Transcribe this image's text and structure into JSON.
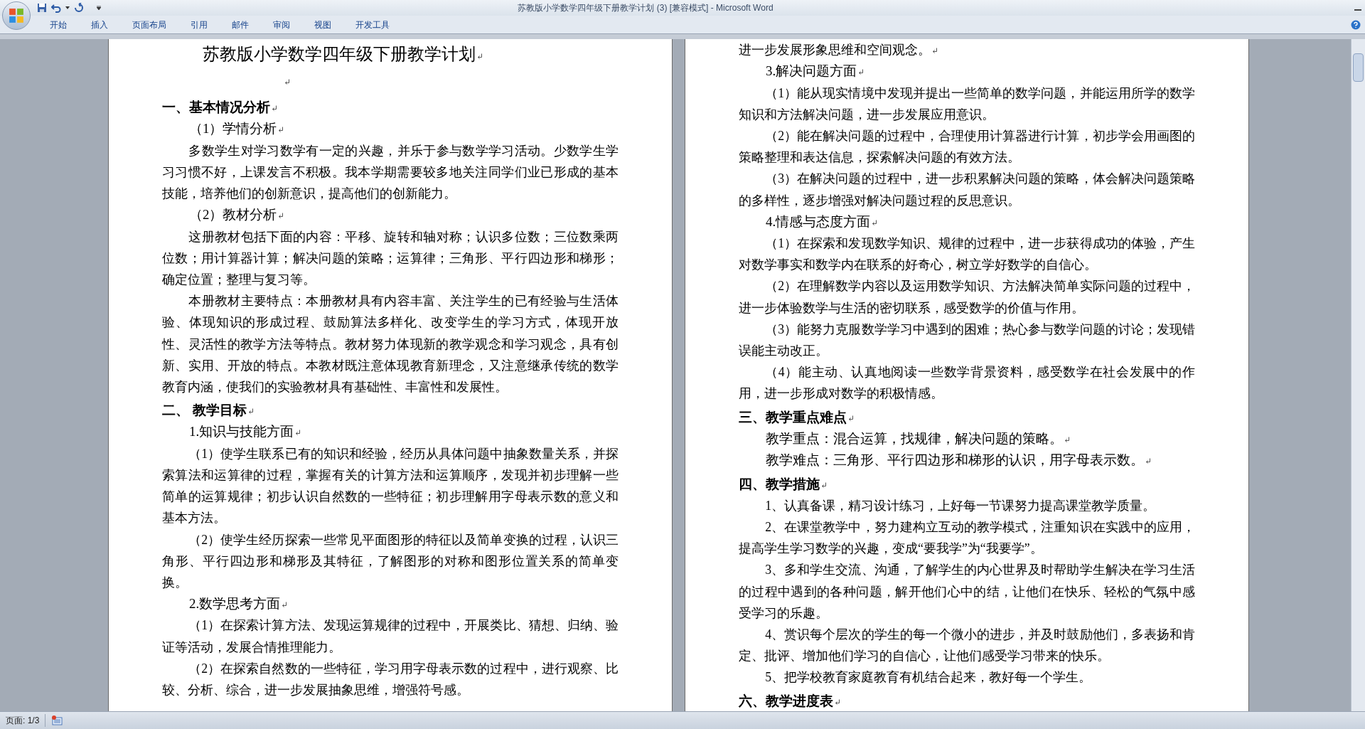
{
  "window": {
    "title": "苏教版小学数学四年级下册教学计划 (3) [兼容模式] - Microsoft Word"
  },
  "ribbon_tabs": [
    {
      "label": "开始",
      "selected": false
    },
    {
      "label": "插入",
      "selected": false
    },
    {
      "label": "页面布局",
      "selected": false
    },
    {
      "label": "引用",
      "selected": false
    },
    {
      "label": "邮件",
      "selected": false
    },
    {
      "label": "审阅",
      "selected": false
    },
    {
      "label": "视图",
      "selected": false
    },
    {
      "label": "开发工具",
      "selected": false
    }
  ],
  "pages": [
    {
      "blocks": [
        {
          "kind": "title",
          "text": "苏教版小学数学四年级下册教学计划"
        },
        {
          "kind": "blank"
        },
        {
          "kind": "heading",
          "text": "一、基本情况分析"
        },
        {
          "kind": "sub",
          "text": "（1）学情分析"
        },
        {
          "kind": "para",
          "text": "多数学生对学习数学有一定的兴趣，并乐于参与数学学习活动。少数学生学习习惯不好，上课发言不积极。我本学期需要较多地关注同学们业已形成的基本技能，培养他们的创新意识，提高他们的创新能力。"
        },
        {
          "kind": "sub",
          "text": "（2）教材分析"
        },
        {
          "kind": "para",
          "text": "这册教材包括下面的内容：平移、旋转和轴对称；认识多位数；三位数乘两位数；用计算器计算；解决问题的策略；运算律；三角形、平行四边形和梯形；确定位置；整理与复习等。"
        },
        {
          "kind": "para",
          "text": "本册教材主要特点：本册教材具有内容丰富、关注学生的已有经验与生活体验、体现知识的形成过程、鼓励算法多样化、改变学生的学习方式，体现开放性、灵活性的教学方法等特点。教材努力体现新的教学观念和学习观念，具有创新、实用、开放的特点。本教材既注意体现教育新理念，又注意继承传统的数学教育内涵，使我们的实验教材具有基础性、丰富性和发展性。"
        },
        {
          "kind": "heading",
          "text": "二、 教学目标"
        },
        {
          "kind": "sub",
          "text": "1.知识与技能方面"
        },
        {
          "kind": "para",
          "text": "（1）使学生联系已有的知识和经验，经历从具体问题中抽象数量关系，并探索算法和运算律的过程，掌握有关的计算方法和运算顺序，发现并初步理解一些简单的运算规律；初步认识自然数的一些特征；初步理解用字母表示数的意义和基本方法。"
        },
        {
          "kind": "para",
          "text": "（2）使学生经历探索一些常见平面图形的特征以及简单变换的过程，认识三角形、平行四边形和梯形及其特征，了解图形的对称和图形位置关系的简单变换。"
        },
        {
          "kind": "sub",
          "text": "2.数学思考方面"
        },
        {
          "kind": "para",
          "text": "（1）在探索计算方法、发现运算规律的过程中，开展类比、猜想、归纳、验证等活动，发展合情推理能力。"
        },
        {
          "kind": "para",
          "text": "（2）在探索自然数的一些特征，学习用字母表示数的过程中，进行观察、比较、分析、综合，进一步发展抽象思维，增强符号感。"
        }
      ]
    },
    {
      "blocks": [
        {
          "kind": "cont",
          "text": "进一步发展形象思维和空间观念。"
        },
        {
          "kind": "sub",
          "text": "3.解决问题方面"
        },
        {
          "kind": "para",
          "text": "（1）能从现实情境中发现并提出一些简单的数学问题，并能运用所学的数学知识和方法解决问题，进一步发展应用意识。"
        },
        {
          "kind": "para",
          "text": "（2）能在解决问题的过程中，合理使用计算器进行计算，初步学会用画图的策略整理和表达信息，探索解决问题的有效方法。"
        },
        {
          "kind": "para",
          "text": "（3）在解决问题的过程中，进一步积累解决问题的策略，体会解决问题策略的多样性，逐步增强对解决问题过程的反思意识。"
        },
        {
          "kind": "sub",
          "text": "4.情感与态度方面"
        },
        {
          "kind": "para",
          "text": "（1）在探索和发现数学知识、规律的过程中，进一步获得成功的体验，产生对数学事实和数学内在联系的好奇心，树立学好数学的自信心。"
        },
        {
          "kind": "para",
          "text": "（2）在理解数学内容以及运用数学知识、方法解决简单实际问题的过程中，进一步体验数学与生活的密切联系，感受数学的价值与作用。"
        },
        {
          "kind": "para",
          "text": "（3）能努力克服数学学习中遇到的困难；热心参与数学问题的讨论；发现错误能主动改正。"
        },
        {
          "kind": "para",
          "text": "（4）能主动、认真地阅读一些数学背景资料，感受数学在社会发展中的作用，进一步形成对数学的积极情感。"
        },
        {
          "kind": "heading",
          "text": "三、教学重点难点"
        },
        {
          "kind": "sub",
          "text": "教学重点：混合运算，找规律，解决问题的策略。"
        },
        {
          "kind": "sub",
          "text": "教学难点：三角形、平行四边形和梯形的认识，用字母表示数。"
        },
        {
          "kind": "heading",
          "text": "四、教学措施"
        },
        {
          "kind": "para",
          "text": "1、认真备课，精习设计练习，上好每一节课努力提高课堂教学质量。"
        },
        {
          "kind": "para",
          "text": "2、在课堂教学中，努力建构立互动的教学模式，注重知识在实践中的应用，提高学生学习数学的兴趣，变成“要我学”为“我要学”。"
        },
        {
          "kind": "para",
          "text": "3、多和学生交流、沟通，了解学生的内心世界及时帮助学生解决在学习生活的过程中遇到的各种问题，解开他们心中的结，让他们在快乐、轻松的气氛中感受学习的乐趣。"
        },
        {
          "kind": "para",
          "text": "4、赏识每个层次的学生的每一个微小的进步，并及时鼓励他们，多表扬和肯定、批评、增加他们学习的自信心，让他们感受学习带来的快乐。"
        },
        {
          "kind": "para",
          "text": "5、把学校教育家庭教育有机结合起来，教好每一个学生。"
        },
        {
          "kind": "heading",
          "text": "六、教学进度表"
        }
      ]
    }
  ],
  "status_bar": {
    "page": "页面: 1/3"
  }
}
